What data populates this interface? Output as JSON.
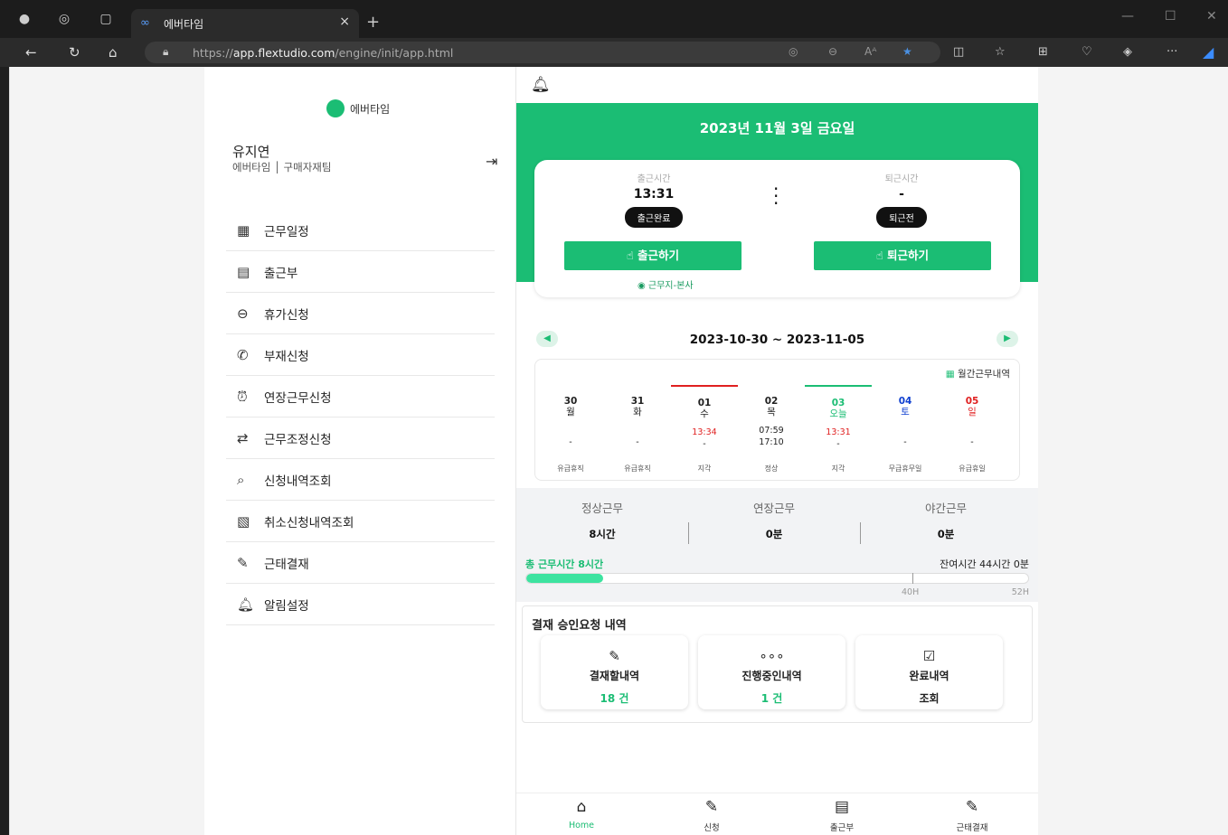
{
  "browser": {
    "tab_title": "에버타임",
    "url_prefix": "https://",
    "url_host": "app.flextudio.com",
    "url_path": "/engine/init/app.html"
  },
  "sidebar": {
    "logo_text": "에버타임",
    "user_name": "유지연",
    "user_org": "에버타임 │ 구매자재팀",
    "items": [
      {
        "label": "근무일정",
        "icon": "calendar-icon"
      },
      {
        "label": "출근부",
        "icon": "attendance-book-icon"
      },
      {
        "label": "휴가신청",
        "icon": "toggle-off-icon"
      },
      {
        "label": "부재신청",
        "icon": "phone-icon"
      },
      {
        "label": "연장근무신청",
        "icon": "alarm-clock-icon"
      },
      {
        "label": "근무조정신청",
        "icon": "swap-icon"
      },
      {
        "label": "신청내역조회",
        "icon": "search-document-icon"
      },
      {
        "label": "취소신청내역조회",
        "icon": "cancel-document-icon"
      },
      {
        "label": "근태결재",
        "icon": "approval-icon"
      },
      {
        "label": "알림설정",
        "icon": "bell-icon"
      }
    ]
  },
  "main": {
    "date_title": "2023년 11월 3일 금요일",
    "checkin": {
      "label": "출근시간",
      "time": "13:31",
      "status": "출근완료",
      "button": "출근하기"
    },
    "checkout": {
      "label": "퇴근시간",
      "time": "-",
      "status": "퇴근전",
      "button": "퇴근하기"
    },
    "location": "근무지-본사",
    "week_range": "2023-10-30 ~ 2023-11-05",
    "monthly_link": "월간근무내역",
    "days": [
      {
        "num": "30",
        "wd": "월",
        "t1": "",
        "t2": "-",
        "status": "유급휴직",
        "color": "normal"
      },
      {
        "num": "31",
        "wd": "화",
        "t1": "",
        "t2": "-",
        "status": "유급휴직",
        "color": "normal"
      },
      {
        "num": "01",
        "wd": "수",
        "t1": "13:34",
        "t2": "-",
        "status": "지각",
        "color": "normal"
      },
      {
        "num": "02",
        "wd": "목",
        "t1": "07:59",
        "t2": "17:10",
        "status": "정상",
        "color": "normal"
      },
      {
        "num": "03",
        "wd": "오늘",
        "t1": "13:31",
        "t2": "-",
        "status": "지각",
        "color": "green"
      },
      {
        "num": "04",
        "wd": "토",
        "t1": "",
        "t2": "-",
        "status": "무급휴무일",
        "color": "blue"
      },
      {
        "num": "05",
        "wd": "일",
        "t1": "",
        "t2": "-",
        "status": "유급휴일",
        "color": "red"
      }
    ],
    "summary": {
      "regular_label": "정상근무",
      "regular_value": "8시간",
      "overtime_label": "연장근무",
      "overtime_value": "0분",
      "night_label": "야간근무",
      "night_value": "0분",
      "total_label": "총 근무시간 8시간",
      "remain_label": "잔여시간 44시간 0분",
      "tick_40": "40H",
      "tick_52": "52H",
      "progress_hours": 8,
      "max_hours": 52
    },
    "approvals": {
      "title": "결재 승인요청 내역",
      "cards": [
        {
          "label": "결재할내역",
          "value": "18 건",
          "icon": "edit-icon"
        },
        {
          "label": "진행중인내역",
          "value": "1 건",
          "icon": "dots-icon"
        },
        {
          "label": "완료내역",
          "value": "조회",
          "icon": "checklist-icon"
        }
      ]
    },
    "bottom_nav": [
      {
        "label": "Home",
        "icon": "home-icon"
      },
      {
        "label": "신청",
        "icon": "edit-icon"
      },
      {
        "label": "출근부",
        "icon": "attendance-book-icon"
      },
      {
        "label": "근태결재",
        "icon": "approval-icon"
      }
    ]
  },
  "colors": {
    "brand": "#1bbd74",
    "late": "#e02020",
    "saturday": "#1040d0"
  }
}
